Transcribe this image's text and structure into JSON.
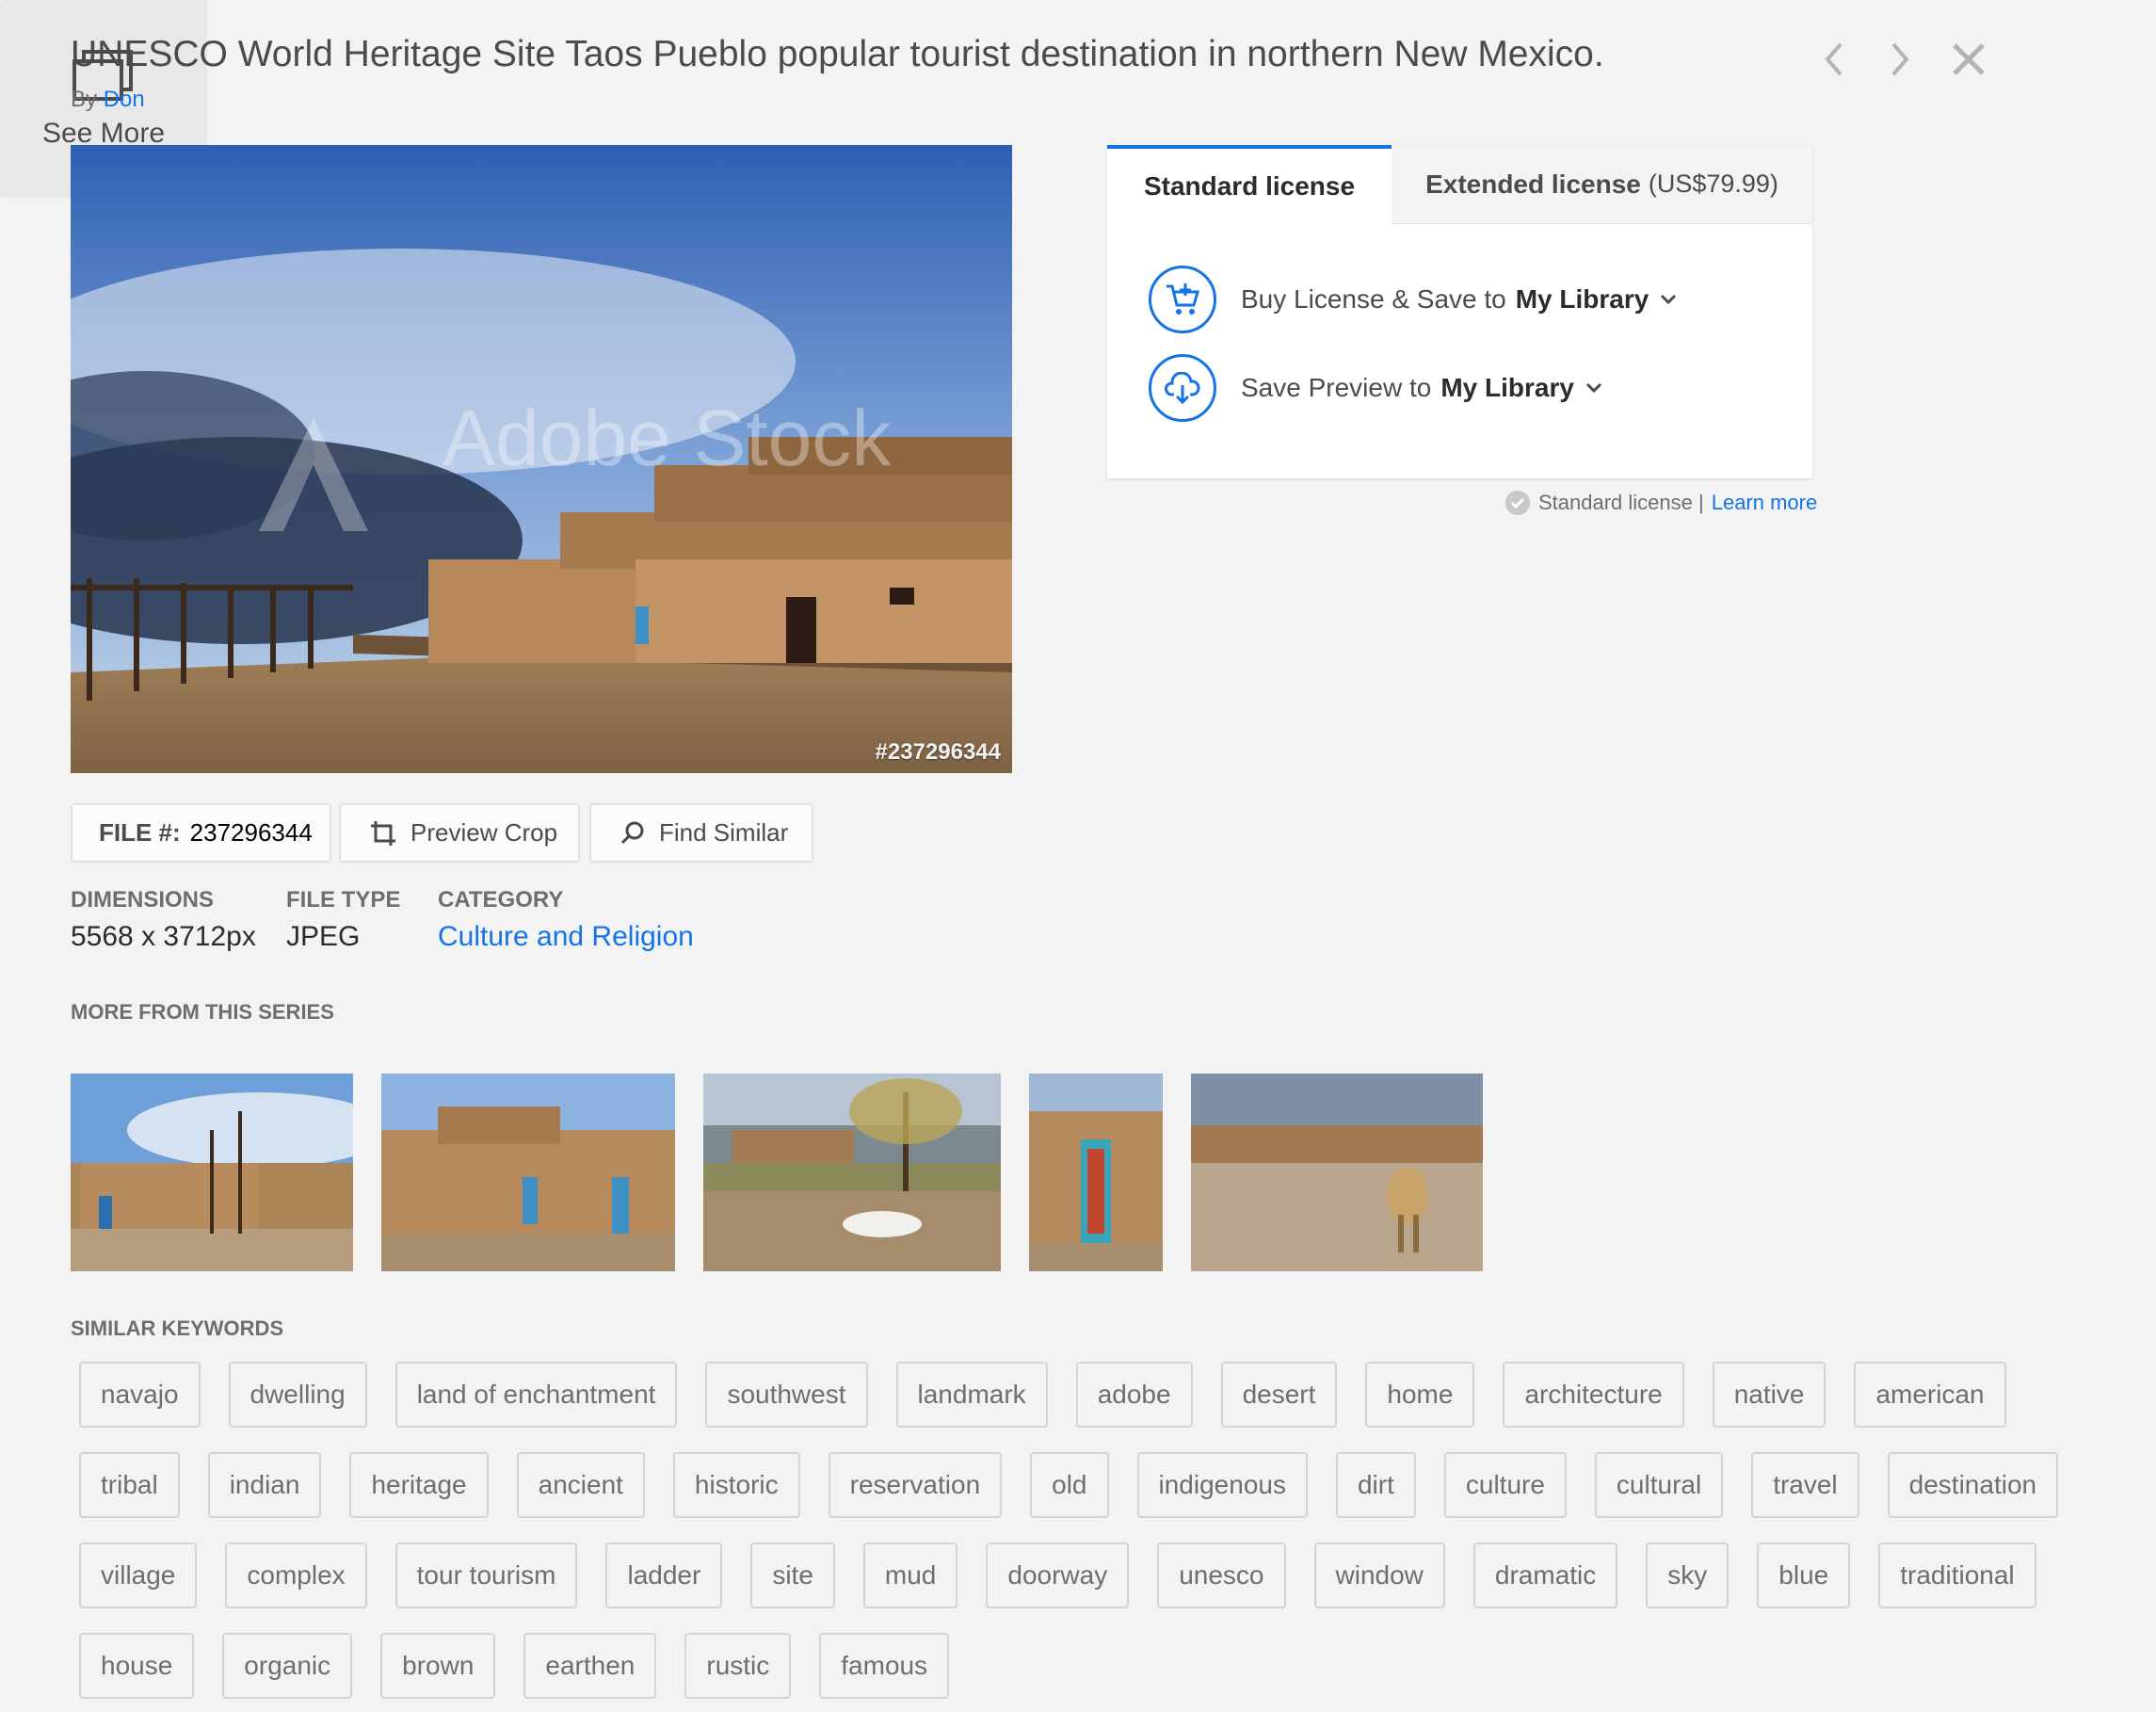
{
  "header": {
    "title": "UNESCO World Heritage Site Taos Pueblo popular tourist destination in northern New Mexico.",
    "by_prefix": "By",
    "author": "Don"
  },
  "image": {
    "watermark": "Adobe Stock",
    "id_label": "#237296344"
  },
  "tools": {
    "file_label": "FILE #:",
    "file_number": "237296344",
    "preview_crop": "Preview Crop",
    "find_similar": "Find Similar"
  },
  "meta": {
    "dimensions_label": "DIMENSIONS",
    "dimensions_value": "5568 x 3712px",
    "filetype_label": "FILE TYPE",
    "filetype_value": "JPEG",
    "category_label": "CATEGORY",
    "category_value": "Culture and Religion"
  },
  "series": {
    "label": "MORE FROM THIS SERIES",
    "see_more": "See More"
  },
  "keywords": {
    "label": "SIMILAR KEYWORDS",
    "rows": [
      [
        "navajo",
        "dwelling",
        "land of enchantment",
        "southwest",
        "landmark",
        "adobe",
        "desert",
        "home",
        "architecture",
        "native",
        "american"
      ],
      [
        "tribal",
        "indian",
        "heritage",
        "ancient",
        "historic",
        "reservation",
        "old",
        "indigenous",
        "dirt",
        "culture",
        "cultural",
        "travel",
        "destination"
      ],
      [
        "village",
        "complex",
        "tour tourism",
        "ladder",
        "site",
        "mud",
        "doorway",
        "unesco",
        "window",
        "dramatic",
        "sky",
        "blue",
        "traditional"
      ],
      [
        "house",
        "organic",
        "brown",
        "earthen",
        "rustic",
        "famous"
      ]
    ]
  },
  "license": {
    "tab_standard": "Standard license",
    "tab_extended": "Extended license",
    "tab_extended_price": "(US$79.99)",
    "buy_text": "Buy License & Save to",
    "buy_target": "My Library",
    "preview_text": "Save Preview to",
    "preview_target": "My Library",
    "note_text": "Standard license |",
    "note_link": "Learn more"
  },
  "colors": {
    "accent": "#1473e6",
    "background": "#f3f3f3"
  }
}
